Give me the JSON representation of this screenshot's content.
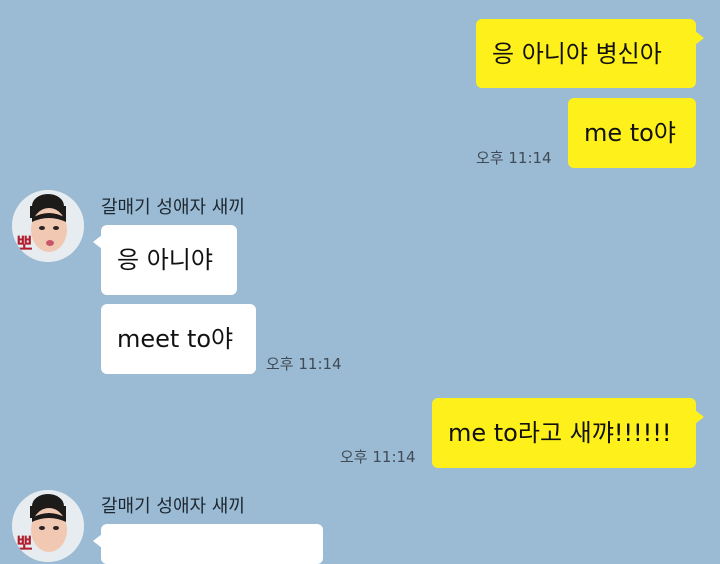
{
  "chat": {
    "messages": [
      {
        "sender": "me",
        "text": "응 아니야 병신아"
      },
      {
        "sender": "me",
        "text": "me to야",
        "time": "오후 11:14"
      },
      {
        "sender": "friend",
        "name": "갈매기 성애자 새끼",
        "text": "응 아니야"
      },
      {
        "sender": "friend",
        "text": "meet to야",
        "time": "오후 11:14"
      },
      {
        "sender": "me",
        "text": "me to라고 새꺄!!!!!!",
        "time": "오후 11:14"
      },
      {
        "sender": "friend",
        "name": "갈매기 성애자 새끼",
        "text": ""
      }
    ]
  },
  "colors": {
    "background": "#9bbbd4",
    "my_bubble": "#fef01b",
    "friend_bubble": "#ffffff"
  },
  "icons": {
    "friend_avatar": "profile-photo-avatar",
    "avatar_badge_glyph": "뽀"
  }
}
